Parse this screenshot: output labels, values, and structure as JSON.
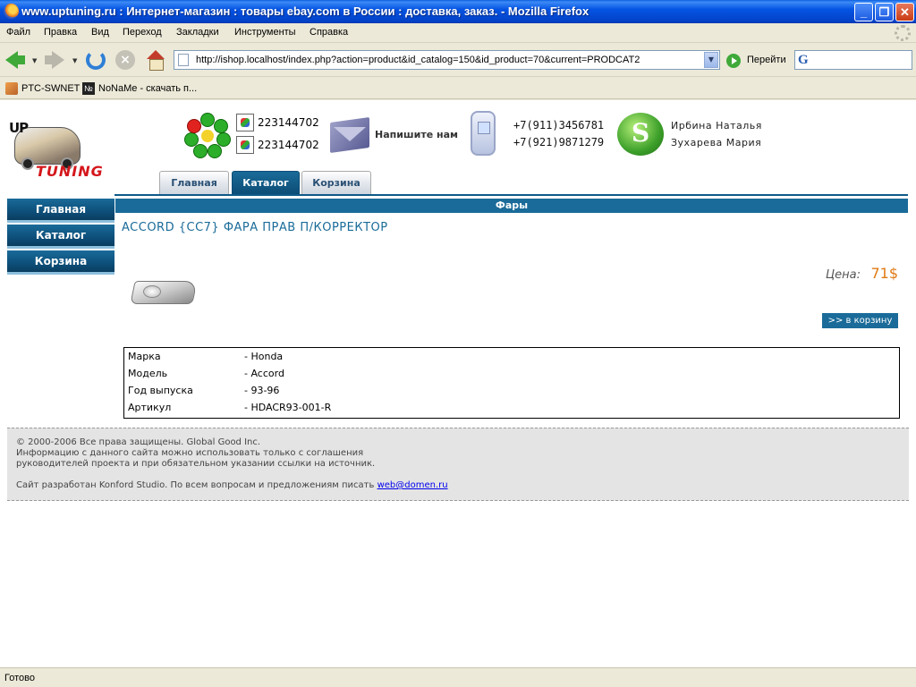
{
  "window": {
    "title": "www.uptuning.ru : Интернет-магазин : товары ebay.com в России : доставка, заказ. - Mozilla Firefox",
    "minimize": "_",
    "maximize": "❐",
    "close": "✕"
  },
  "menu": [
    "Файл",
    "Правка",
    "Вид",
    "Переход",
    "Закладки",
    "Инструменты",
    "Справка"
  ],
  "toolbar": {
    "url": "http://ishop.localhost/index.php?action=product&id_catalog=150&id_product=70&current=PRODCAT2",
    "go_label": "Перейти",
    "dropdown": "▼",
    "search_logo": "G"
  },
  "bookmarks": [
    {
      "label": "PTC-SWNET",
      "icon": "rss-feed-icon"
    },
    {
      "label": "NoNaMe - скачать п...",
      "icon": "numero-sign-icon",
      "icon_text": "№"
    }
  ],
  "header": {
    "logo_top": "UP",
    "logo_bottom": "TUNING",
    "icq_numbers": [
      "223144702",
      "223144702"
    ],
    "write_us": "Напишите нам",
    "phones": [
      "+7(911)3456781",
      "+7(921)9871279"
    ],
    "contacts": [
      "Ирбина Наталья",
      "Зухарева Мария"
    ]
  },
  "tabs": [
    {
      "label": "Главная",
      "active": false
    },
    {
      "label": "Каталог",
      "active": true
    },
    {
      "label": "Корзина",
      "active": false
    }
  ],
  "sidebar": {
    "items": [
      {
        "label": "Главная"
      },
      {
        "label": "Каталог"
      },
      {
        "label": "Корзина"
      }
    ]
  },
  "product": {
    "section": "Фары",
    "title": "ACCORD {CC7} ФАРА ПРАВ П/КОРРЕКТОР",
    "price_label": "Цена:",
    "price_value": "71$",
    "cart_button": ">> в корзину",
    "specs": [
      {
        "key": "Марка",
        "value": "- Honda"
      },
      {
        "key": "Модель",
        "value": "- Accord"
      },
      {
        "key": "Год выпуска",
        "value": "- 93-96"
      },
      {
        "key": "Артикул",
        "value": "- HDACR93-001-R"
      }
    ]
  },
  "footer": {
    "line1": "© 2000-2006 Все права защищены. Global Good Inc.",
    "line2": "Информацию с данного сайта можно использовать только с соглашения",
    "line3": "руководителей проекта и при обязательном указании ссылки на источник.",
    "line4": "Сайт разработан Konford Studio. По всем вопросам и предложениям писать",
    "email": "web@domen.ru"
  },
  "status": "Готово",
  "colors": {
    "accent": "#1a6b99",
    "price": "#e07a14",
    "title_bar": "#0554e3"
  }
}
